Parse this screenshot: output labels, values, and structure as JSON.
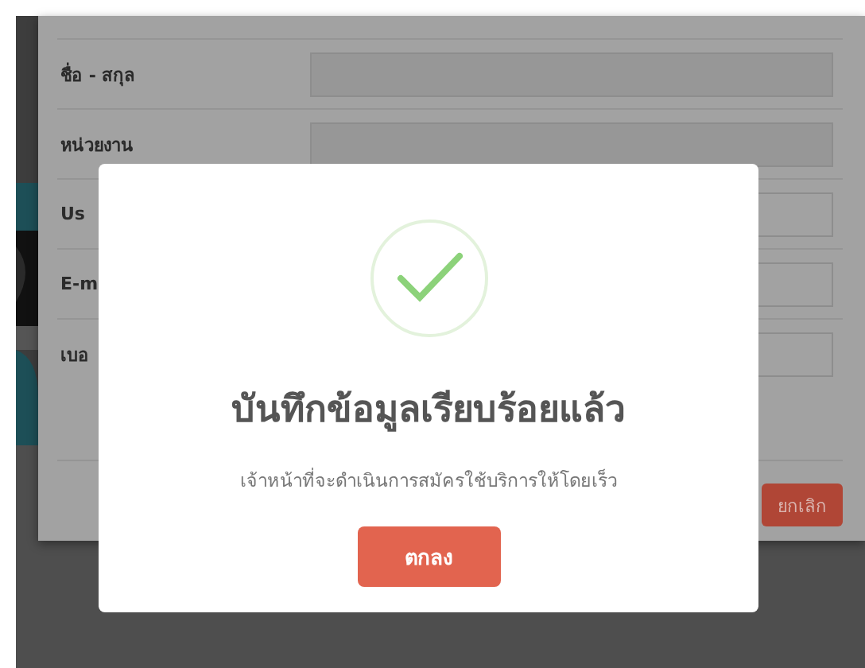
{
  "form": {
    "fields": [
      {
        "label": "ชื่อ - สกุล"
      },
      {
        "label": "หน่วยงาน"
      },
      {
        "label": "Us"
      },
      {
        "label": "E-m"
      },
      {
        "label": "เบอ"
      }
    ],
    "cancel_button": "ยกเลิก"
  },
  "dialog": {
    "title": "บันทึกข้อมูลเรียบร้อยแล้ว",
    "message": "เจ้าหน้าที่จะดำเนินการสมัครใช้บริการให้โดยเร็ว",
    "ok_button": "ตกลง"
  }
}
